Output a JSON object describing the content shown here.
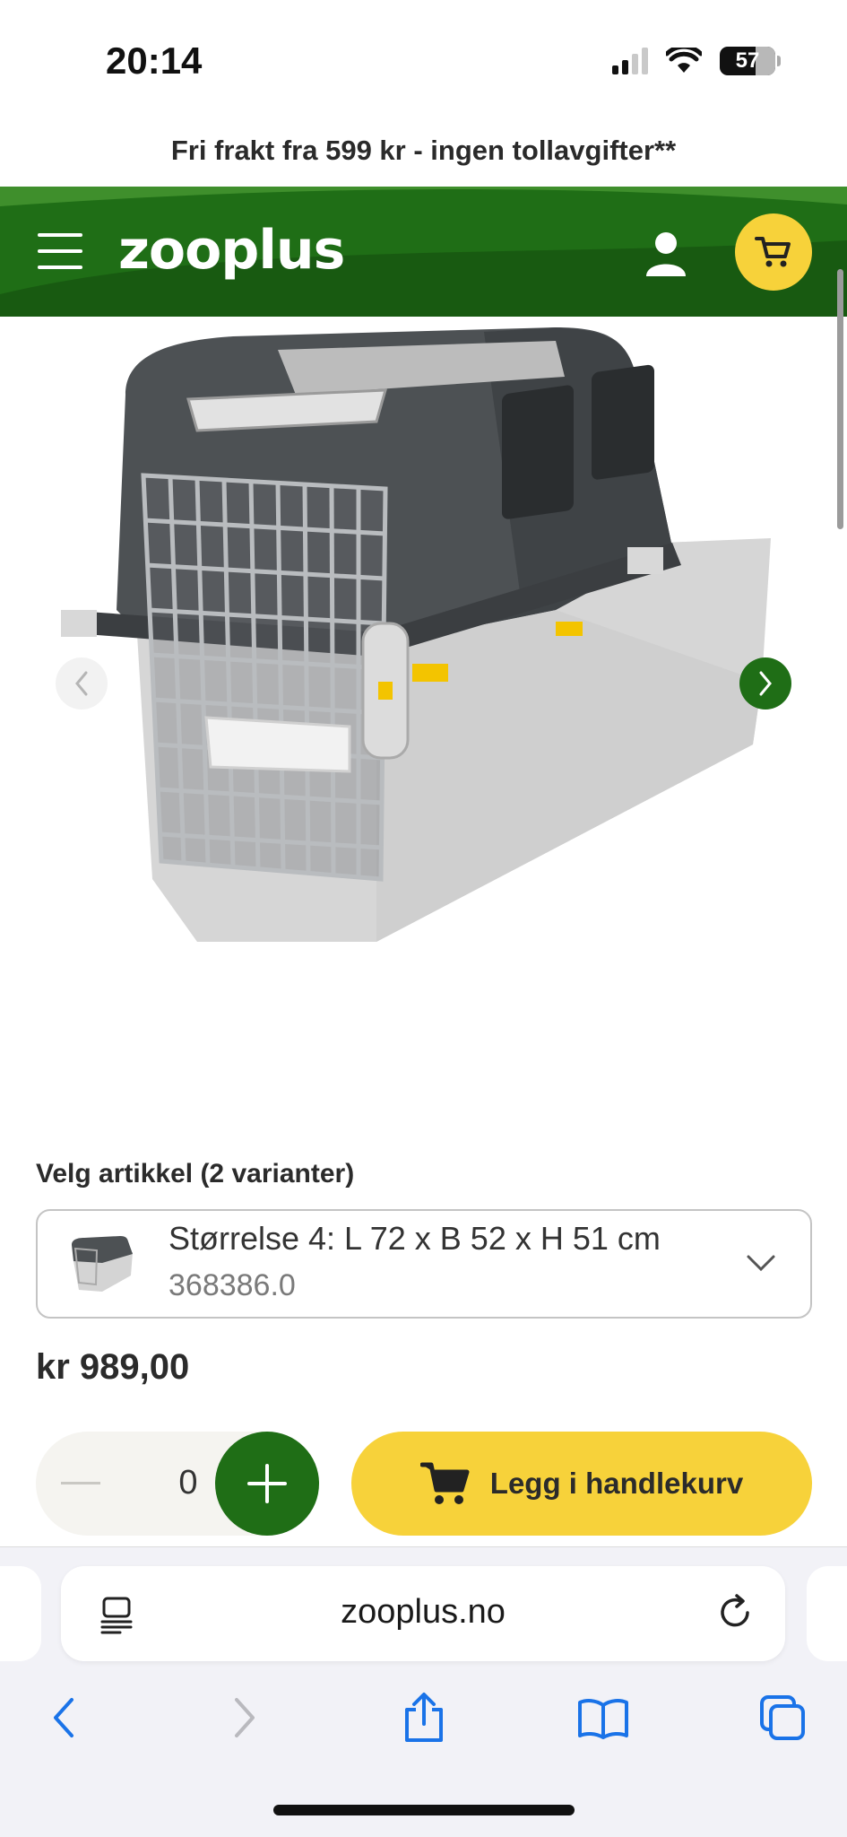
{
  "status_bar": {
    "time": "20:14",
    "battery_percent": "57",
    "icons": [
      "cellular-signal-icon",
      "wifi-icon",
      "battery-icon"
    ]
  },
  "promo": {
    "text": "Fri frakt fra 599 kr - ingen tollavgifter**"
  },
  "header": {
    "logo": "zooplus",
    "icons": [
      "menu-icon",
      "user-icon",
      "cart-icon"
    ],
    "colors": {
      "header_bg": "#1f6e16",
      "cart_bg": "#f7d23a"
    }
  },
  "product": {
    "image": "pet-transport-crate",
    "carousel": {
      "prev_icon": "chevron-left-icon",
      "next_icon": "chevron-right-icon"
    },
    "variant_heading": "Velg artikkel (2 varianter)",
    "selected_variant": {
      "name": "Størrelse 4: L 72 x B 52 x H 51 cm",
      "code": "368386.0"
    },
    "price": "kr 989,00",
    "quantity": "0",
    "add_to_cart_label": "Legg i handlekurv",
    "colors": {
      "accent_green": "#1f6e16",
      "accent_yellow": "#f7d23a"
    }
  },
  "browser": {
    "url": "zooplus.no",
    "icons": [
      "reader-icon",
      "reload-icon",
      "back-icon",
      "forward-icon",
      "share-icon",
      "bookmarks-icon",
      "tabs-icon"
    ]
  }
}
